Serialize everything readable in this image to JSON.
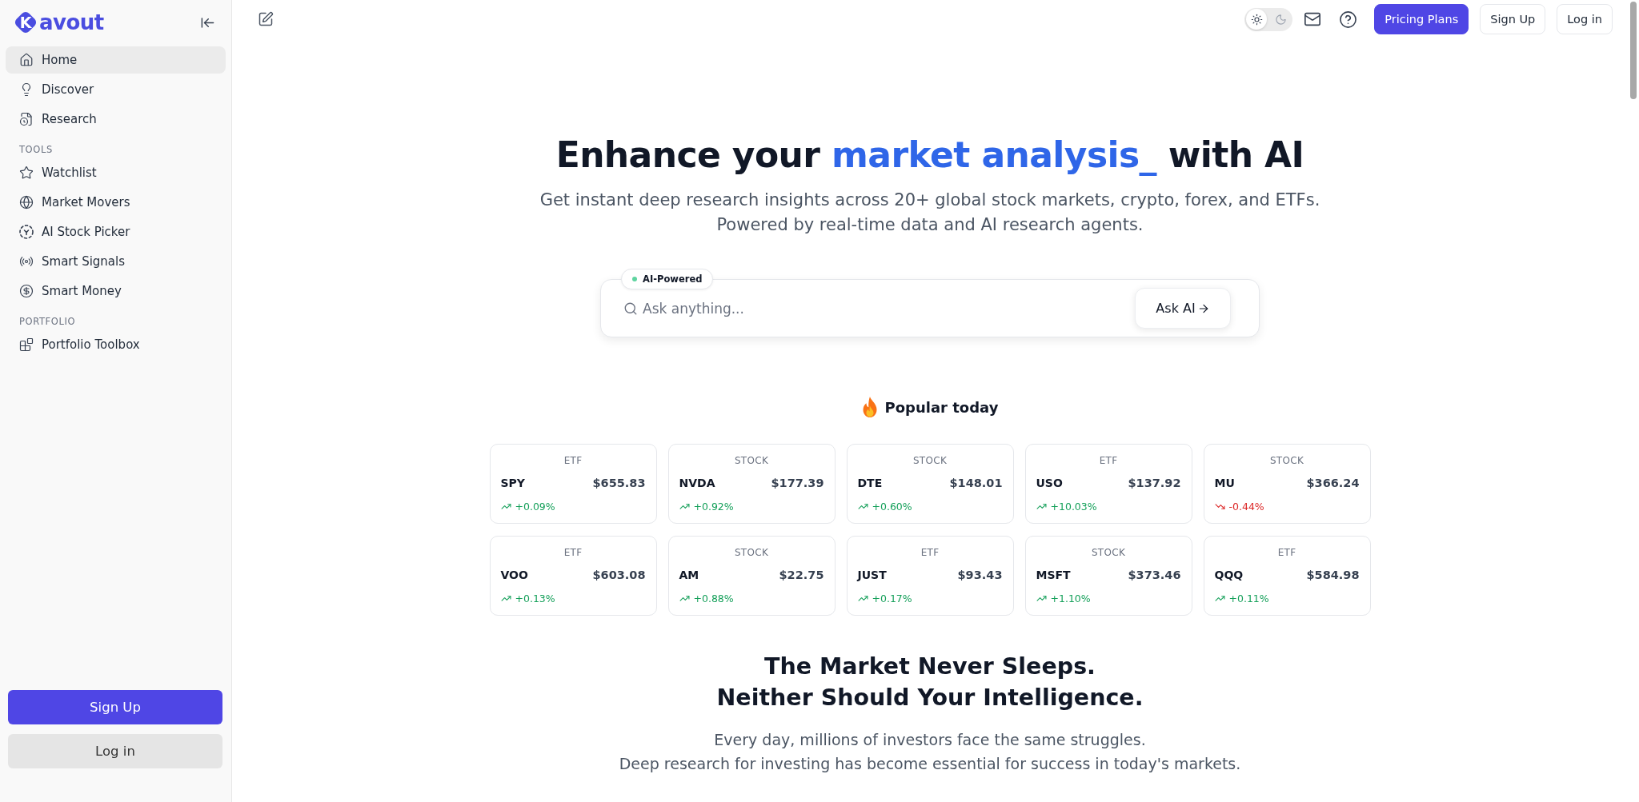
{
  "sidebar": {
    "brand": {
      "mark": "K",
      "name": "avout"
    },
    "nav": [
      {
        "label": "Home",
        "selected": true
      },
      {
        "label": "Discover",
        "selected": false
      },
      {
        "label": "Research",
        "selected": false
      }
    ],
    "sections": [
      {
        "title": "TOOLS",
        "items": [
          {
            "label": "Watchlist",
            "selected": false
          },
          {
            "label": "Market Movers",
            "selected": false
          },
          {
            "label": "AI Stock Picker",
            "selected": false
          },
          {
            "label": "Smart Signals",
            "selected": false
          },
          {
            "label": "Smart Money",
            "selected": false
          }
        ]
      },
      {
        "title": "PORTFOLIO",
        "items": [
          {
            "label": "Portfolio Toolbox",
            "selected": false
          }
        ]
      }
    ],
    "buttons": [
      {
        "label": "Sign Up",
        "kind": "primary"
      },
      {
        "label": "Log in",
        "kind": "secondary"
      }
    ]
  },
  "header": {
    "theme_options": [
      {
        "kind": "sun",
        "selected": true
      },
      {
        "kind": "moon",
        "selected": false
      }
    ],
    "buttons": [
      {
        "label": "Pricing Plans",
        "kind": "primary"
      },
      {
        "label": "Sign Up",
        "kind": "outline"
      },
      {
        "label": "Log in",
        "kind": "outline"
      }
    ]
  },
  "hero": {
    "title_start": "Enhance your",
    "title_highlight": "market analysis_",
    "title_end": "with AI",
    "subtitle_lines": [
      "Get instant deep research insights across 20+ global stock markets, crypto, forex, and ETFs.",
      "Powered by real-time data and AI research agents."
    ]
  },
  "search": {
    "tag": "AI-Powered",
    "placeholder": "Ask anything...",
    "button": "Ask AI"
  },
  "popular": {
    "title": "Popular today",
    "cards": [
      {
        "type": "ETF",
        "ticker": "SPY",
        "price": "$655.83",
        "change": "+0.09%",
        "rising": true
      },
      {
        "type": "STOCK",
        "ticker": "NVDA",
        "price": "$177.39",
        "change": "+0.92%",
        "rising": true
      },
      {
        "type": "STOCK",
        "ticker": "DTE",
        "price": "$148.01",
        "change": "+0.60%",
        "rising": true
      },
      {
        "type": "ETF",
        "ticker": "USO",
        "price": "$137.92",
        "change": "+10.03%",
        "rising": true
      },
      {
        "type": "STOCK",
        "ticker": "MU",
        "price": "$366.24",
        "change": "-0.44%",
        "rising": false
      },
      {
        "type": "ETF",
        "ticker": "VOO",
        "price": "$603.08",
        "change": "+0.13%",
        "rising": true
      },
      {
        "type": "STOCK",
        "ticker": "AM",
        "price": "$22.75",
        "change": "+0.88%",
        "rising": true
      },
      {
        "type": "ETF",
        "ticker": "JUST",
        "price": "$93.43",
        "change": "+0.17%",
        "rising": true
      },
      {
        "type": "STOCK",
        "ticker": "MSFT",
        "price": "$373.46",
        "change": "+1.10%",
        "rising": true
      },
      {
        "type": "ETF",
        "ticker": "QQQ",
        "price": "$584.98",
        "change": "+0.11%",
        "rising": true
      }
    ]
  },
  "pitch": {
    "heading_lines": [
      "The Market Never Sleeps.",
      "Neither Should Your Intelligence."
    ],
    "body_lines": [
      "Every day, millions of investors face the same struggles.",
      "Deep research for investing has become essential for success in today's markets."
    ]
  }
}
